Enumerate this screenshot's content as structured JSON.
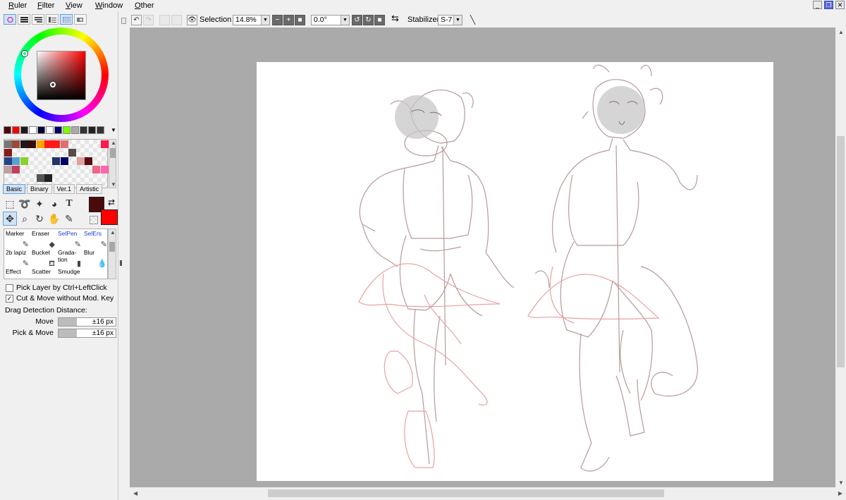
{
  "menu": [
    "Ruler",
    "Filter",
    "View",
    "Window",
    "Other"
  ],
  "window_controls": [
    "minimize",
    "restore",
    "close"
  ],
  "color_tabs": [
    "color-wheel",
    "rgb-sliders",
    "hsv-sliders",
    "color-history",
    "swatches",
    "scratchpad"
  ],
  "palette_row": [
    "#4a0a0a",
    "#ff0000",
    "#1a1a1a",
    "#ffffff",
    "#000033",
    "#ffffff",
    "#000066",
    "#7cfc00",
    "#aaaaaa",
    "#333333",
    "#222222",
    "#333333"
  ],
  "palette_grid": [
    [
      "#777777",
      "#9a4a3a",
      "#1a1a1a",
      "#3a0a0a",
      "#ffa500",
      "#ff1a1a",
      "#ff1a1a",
      "#e07070",
      "",
      "",
      "",
      "",
      "#ff1a4a"
    ],
    [
      "#8a1a1a",
      "",
      "",
      "",
      "",
      "",
      "",
      "",
      "#5a4a4a",
      "",
      "",
      "",
      ""
    ],
    [
      "#224488",
      "#5aa0d0",
      "#8ad030",
      "",
      "",
      "",
      "#223366",
      "#000066",
      "",
      "#e0a0a0",
      "#5a0a0a",
      "",
      ""
    ],
    [
      "#c0a0a0",
      "#c04060",
      "",
      "",
      "",
      "",
      "",
      "",
      "",
      "",
      "",
      "#ee6688",
      "#ff66aa"
    ],
    [
      "",
      "",
      "",
      "",
      "#555555",
      "#222222",
      "",
      "",
      "",
      "",
      "",
      "",
      ""
    ]
  ],
  "tool_tabs": [
    "Basic",
    "Binary",
    "Ver.1",
    "Artistic"
  ],
  "tools": [
    "select-rect",
    "lasso",
    "magic-wand",
    "fill-shape",
    "text",
    "move",
    "zoom",
    "rotate",
    "hand",
    "eyedropper"
  ],
  "colors": {
    "foreground": "#4a0a0a",
    "background": "#ff0000"
  },
  "brushes": [
    {
      "label": "Marker",
      "blue": false
    },
    {
      "label": "Eraser",
      "blue": false
    },
    {
      "label": "SelPen",
      "blue": true
    },
    {
      "label": "SelErs",
      "blue": true
    },
    {
      "label": "2b lapiz",
      "blue": false
    },
    {
      "label": "Bucket",
      "blue": false
    },
    {
      "label": "Grada-\ntion",
      "blue": false
    },
    {
      "label": "Blur",
      "blue": false
    },
    {
      "label": "Effect",
      "blue": false
    },
    {
      "label": "Scatter",
      "blue": false
    },
    {
      "label": "Smudge",
      "blue": false
    }
  ],
  "options": {
    "pick_layer": {
      "label": "Pick Layer by Ctrl+LeftClick",
      "checked": false
    },
    "cut_move": {
      "label": "Cut & Move without Mod. Key",
      "checked": true
    },
    "drag_detection": "Drag Detection Distance:",
    "move": {
      "label": "Move",
      "value": "±16 px",
      "fill": 0.32
    },
    "pick_move": {
      "label": "Pick & Move",
      "value": "±16 px",
      "fill": 0.32
    }
  },
  "toolbar": {
    "selection_label": "Selection",
    "zoom": "14.8%",
    "rotation": "0.0°",
    "stabilizer_label": "Stabilizer",
    "stabilizer": "S-7"
  }
}
